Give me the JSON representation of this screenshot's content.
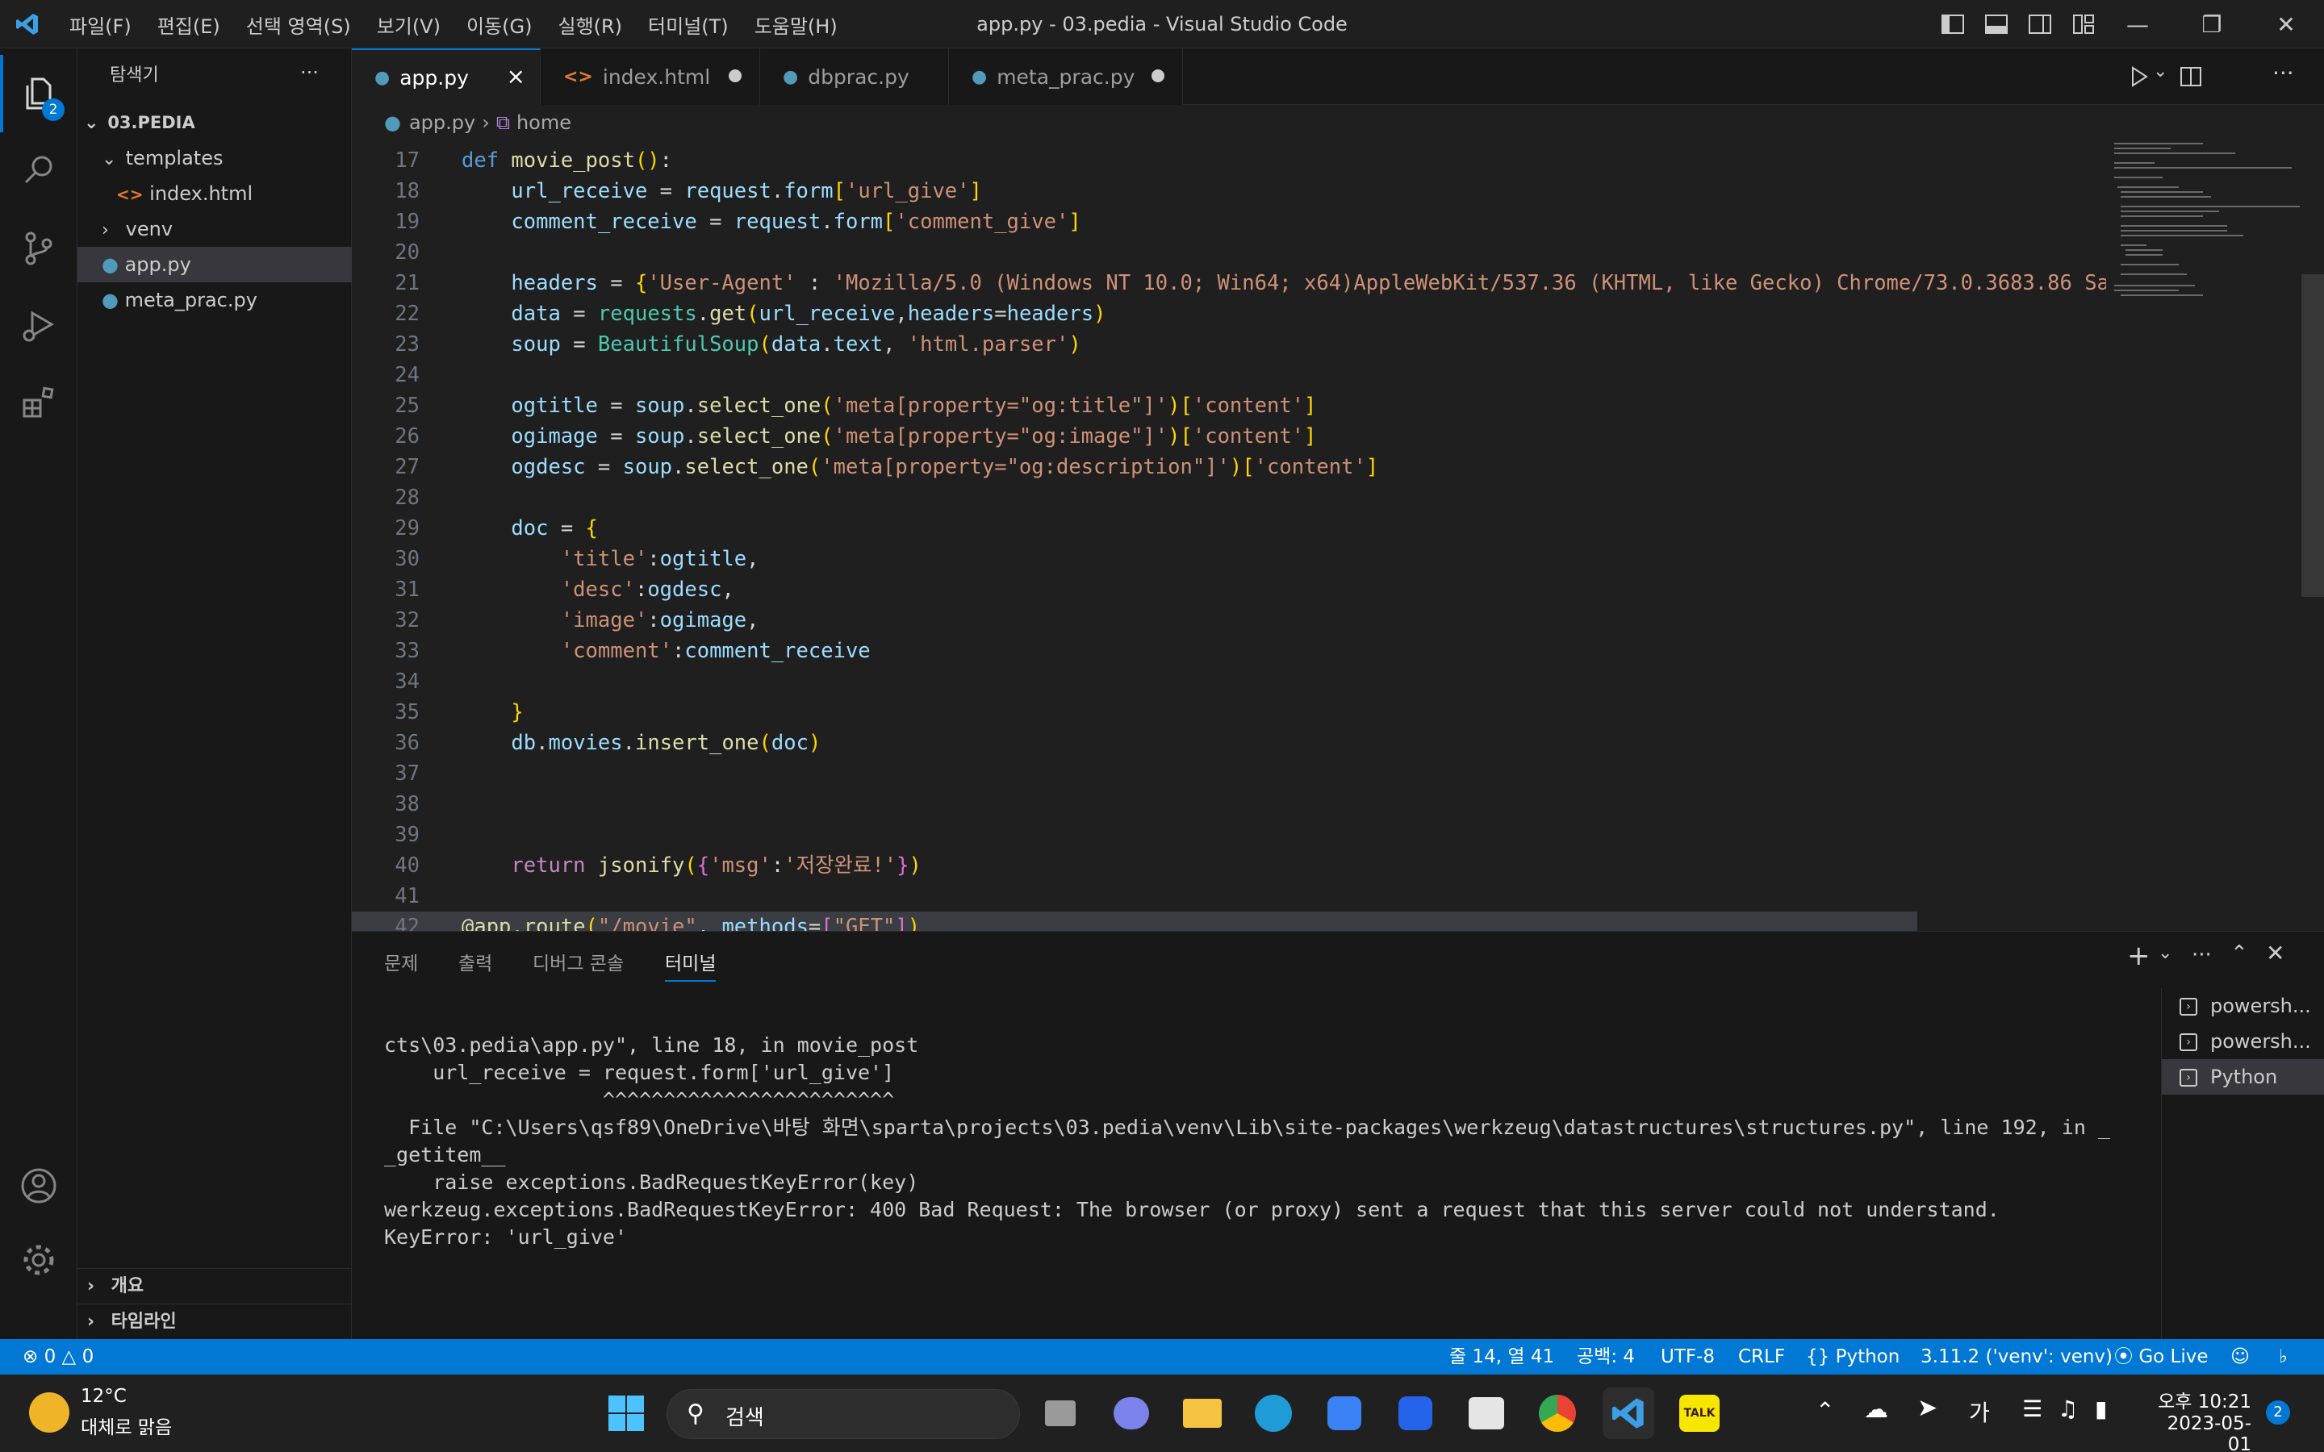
{
  "window": {
    "title": "app.py - 03.pedia - Visual Studio Code",
    "menu": [
      "파일(F)",
      "편집(E)",
      "선택 영역(S)",
      "보기(V)",
      "이동(G)",
      "실행(R)",
      "터미널(T)",
      "도움말(H)"
    ]
  },
  "activity": {
    "explorer_badge": "2"
  },
  "sidebar": {
    "title": "탐색기",
    "more": "···",
    "project": "03.PEDIA",
    "items": [
      {
        "label": "templates",
        "kind": "folder-open"
      },
      {
        "label": "index.html",
        "kind": "html"
      },
      {
        "label": "venv",
        "kind": "folder"
      },
      {
        "label": "app.py",
        "kind": "python"
      },
      {
        "label": "meta_prac.py",
        "kind": "python"
      }
    ],
    "sections": [
      "개요",
      "타임라인"
    ]
  },
  "tabs": [
    {
      "label": "app.py",
      "icon": "python-icon"
    },
    {
      "label": "index.html",
      "icon": "html-icon"
    },
    {
      "label": "dbprac.py",
      "icon": "python-icon"
    },
    {
      "label": "meta_prac.py",
      "icon": "python-icon"
    }
  ],
  "breadcrumb": {
    "file": "app.py",
    "symbol": "home"
  },
  "editor": {
    "line_numbers": [
      "17",
      "18",
      "19",
      "20",
      "21",
      "22",
      "23",
      "24",
      "25",
      "26",
      "27",
      "28",
      "29",
      "30",
      "31",
      "32",
      "33",
      "34",
      "35",
      "36",
      "37",
      "38",
      "39",
      "40",
      "41",
      "42"
    ]
  },
  "panel": {
    "tabs": [
      "문제",
      "출력",
      "디버그 콘솔",
      "터미널"
    ],
    "terminal_lines": [
      "cts\\03.pedia\\app.py\", line 18, in movie_post",
      "    url_receive = request.form['url_give']",
      "                  ^^^^^^^^^^^^^^^^^^^^^^^^",
      "  File \"C:\\Users\\qsf89\\OneDrive\\바탕 화면\\sparta\\projects\\03.pedia\\venv\\Lib\\site-packages\\werkzeug\\datastructures\\structures.py\", line 192, in _",
      "_getitem__",
      "    raise exceptions.BadRequestKeyError(key)",
      "werkzeug.exceptions.BadRequestKeyError: 400 Bad Request: The browser (or proxy) sent a request that this server could not understand.",
      "KeyError: 'url_give'"
    ],
    "terminals": [
      "powersh...",
      "powersh...",
      "Python"
    ]
  },
  "statusbar": {
    "errors": "0",
    "warnings": "0",
    "position": "줄 14, 열 41",
    "spaces": "공백: 4",
    "encoding": "UTF-8",
    "eol": "CRLF",
    "language": "Python",
    "interpreter": "3.11.2 ('venv': venv)",
    "golive": "Go Live"
  },
  "taskbar": {
    "weather_temp": "12°C",
    "weather_desc": "대체로 맑음",
    "search": "검색",
    "ime": "가",
    "time_ampm": "오후 10:21",
    "date": "2023-05-01",
    "notif": "2",
    "talk": "TALK"
  },
  "colors": {
    "accent": "#0078d4",
    "statusbar": "#0078d4",
    "editor_bg": "#1f1f1f"
  }
}
